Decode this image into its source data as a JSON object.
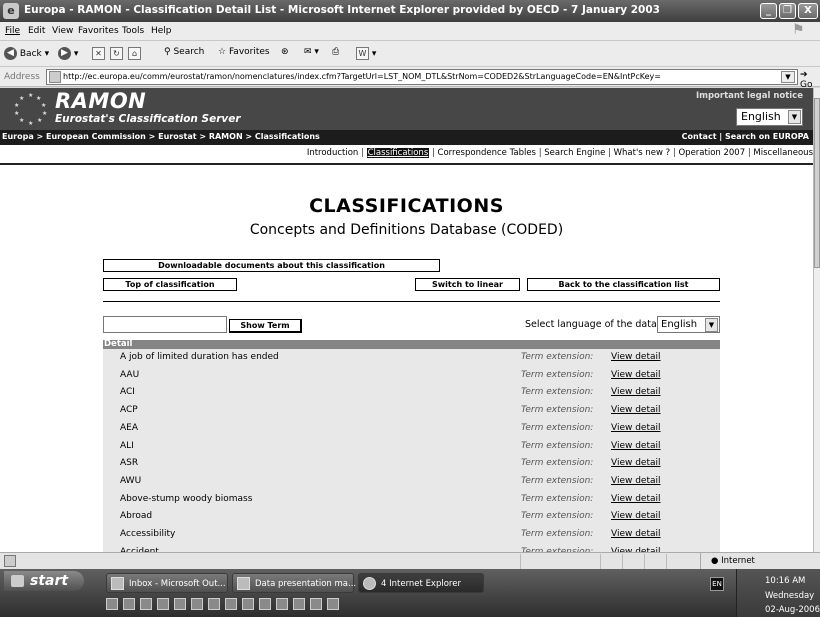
{
  "window": {
    "title": "Europa - RAMON - Classification Detail List - Microsoft Internet Explorer provided by OECD - 7 January 2003",
    "minimize": "_",
    "restore": "❐",
    "close": "X"
  },
  "menu": [
    "File",
    "Edit",
    "View",
    "Favorites",
    "Tools",
    "Help"
  ],
  "toolbar": {
    "back": "Back",
    "search": "Search",
    "favorites": "Favorites"
  },
  "address": {
    "label": "Address",
    "url": "http://ec.europa.eu/comm/eurostat/ramon/nomenclatures/index.cfm?TargetUrl=LST_NOM_DTL&StrNom=CODED2&StrLanguageCode=EN&IntPcKey=",
    "go": "Go"
  },
  "header": {
    "title": "RAMON",
    "subtitle": "Eurostat's Classification Server",
    "legal": "Important legal notice",
    "language": "English"
  },
  "breadcrumb": "Europa > European Commission > Eurostat > RAMON > Classifications",
  "contact": "Contact | Search on EUROPA",
  "nav": {
    "introduction": "Introduction",
    "classifications": "Classifications",
    "correspondence": "Correspondence Tables",
    "search": "Search Engine",
    "whatsnew": "What's new ?",
    "operation": "Operation 2007",
    "misc": "Miscellaneous"
  },
  "page": {
    "heading": "CLASSIFICATIONS",
    "subheading": "Concepts and Definitions Database (CODED)"
  },
  "buttons": {
    "downloadable": "Downloadable documents about this classification",
    "top": "Top of classification",
    "switch": "Switch to linear",
    "back": "Back to the classification list",
    "show_term": "Show Term"
  },
  "select_language": {
    "label": "Select language of the data:",
    "value": "English"
  },
  "detail": {
    "header": "Detail",
    "rows": [
      {
        "term": "A job of limited duration has ended",
        "ext": "Term extension:",
        "link": "View detail"
      },
      {
        "term": "AAU",
        "ext": "Term extension:",
        "link": "View detail"
      },
      {
        "term": "ACI",
        "ext": "Term extension:",
        "link": "View detail"
      },
      {
        "term": "ACP",
        "ext": "Term extension:",
        "link": "View detail"
      },
      {
        "term": "AEA",
        "ext": "Term extension:",
        "link": "View detail"
      },
      {
        "term": "ALI",
        "ext": "Term extension:",
        "link": "View detail"
      },
      {
        "term": "ASR",
        "ext": "Term extension:",
        "link": "View detail"
      },
      {
        "term": "AWU",
        "ext": "Term extension:",
        "link": "View detail"
      },
      {
        "term": "Above-stump woody biomass",
        "ext": "Term extension:",
        "link": "View detail"
      },
      {
        "term": "Abroad",
        "ext": "Term extension:",
        "link": "View detail"
      },
      {
        "term": "Accessibility",
        "ext": "Term extension:",
        "link": "View detail"
      },
      {
        "term": "Accident",
        "ext": "Term extension:",
        "link": "View detail"
      }
    ]
  },
  "status": {
    "zone": "Internet"
  },
  "taskbar": {
    "start": "start",
    "tasks": [
      "Inbox - Microsoft Out...",
      "Data presentation ma...",
      "4 Internet Explorer"
    ],
    "lang": "EN",
    "time": "10:16 AM",
    "day": "Wednesday",
    "date": "02-Aug-2006"
  }
}
